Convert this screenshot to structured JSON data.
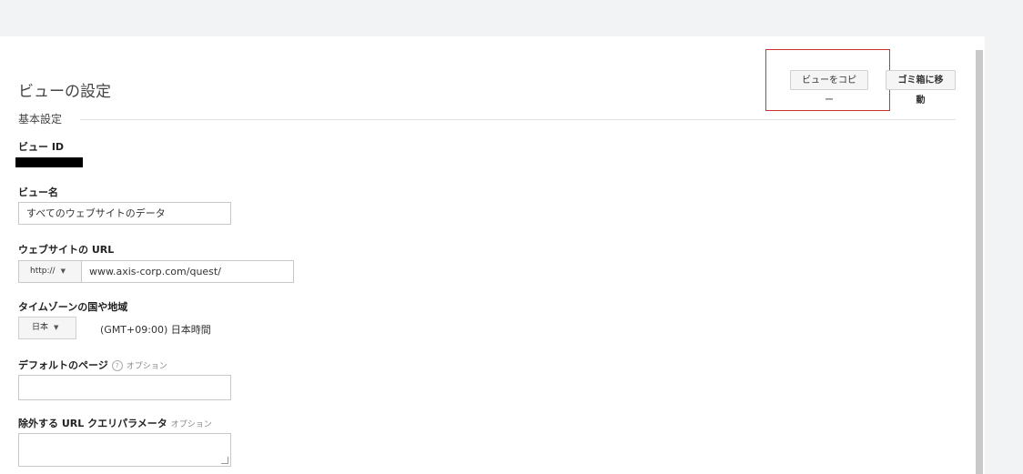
{
  "page": {
    "title": "ビューの設定"
  },
  "toolbar": {
    "copy_view_label": "ビューをコピー",
    "move_to_trash_label": "ゴミ箱に移動"
  },
  "section": {
    "header": "基本設定"
  },
  "view_id": {
    "label": "ビュー ID"
  },
  "view_name": {
    "label": "ビュー名",
    "value": "すべてのウェブサイトのデータ"
  },
  "website_url": {
    "label": "ウェブサイトの URL",
    "protocol": "http://",
    "value": "www.axis-corp.com/quest/"
  },
  "timezone": {
    "label": "タイムゾーンの国や地域",
    "country": "日本",
    "zone_text": "(GMT+09:00) 日本時間"
  },
  "default_page": {
    "label": "デフォルトのページ",
    "optional": "オプション",
    "help": "?"
  },
  "exclude_params": {
    "label": "除外する URL クエリパラメータ",
    "optional": "オプション"
  },
  "colors": {
    "highlight": "#d32f2f",
    "background": "#f1f3f4",
    "panel": "#ffffff"
  }
}
